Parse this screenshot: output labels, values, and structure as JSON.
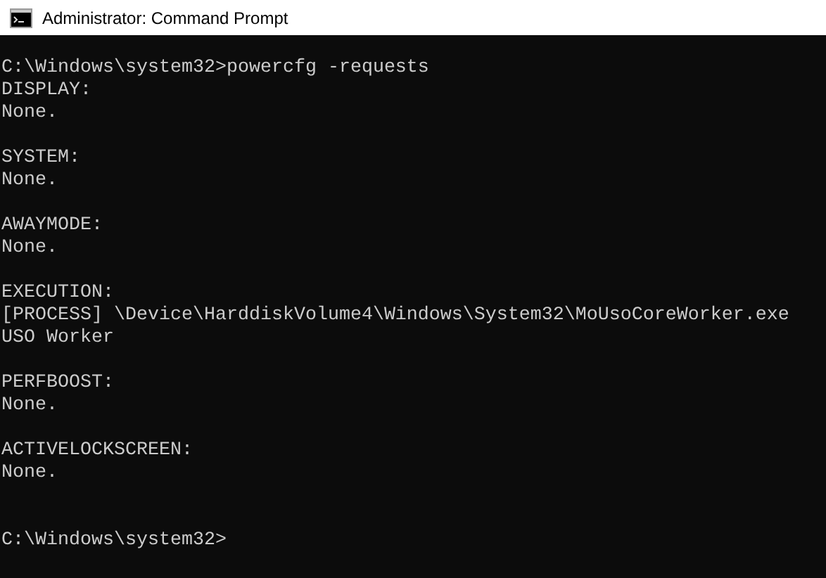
{
  "window": {
    "title": "Administrator: Command Prompt"
  },
  "console": {
    "lines": [
      {
        "kind": "blank"
      },
      {
        "kind": "text",
        "text": "C:\\Windows\\system32>powercfg -requests"
      },
      {
        "kind": "text",
        "text": "DISPLAY:"
      },
      {
        "kind": "text",
        "text": "None."
      },
      {
        "kind": "blank"
      },
      {
        "kind": "text",
        "text": "SYSTEM:"
      },
      {
        "kind": "text",
        "text": "None."
      },
      {
        "kind": "blank"
      },
      {
        "kind": "text",
        "text": "AWAYMODE:"
      },
      {
        "kind": "text",
        "text": "None."
      },
      {
        "kind": "blank"
      },
      {
        "kind": "text",
        "text": "EXECUTION:"
      },
      {
        "kind": "text",
        "text": "[PROCESS] \\Device\\HarddiskVolume4\\Windows\\System32\\MoUsoCoreWorker.exe"
      },
      {
        "kind": "text",
        "text": "USO Worker"
      },
      {
        "kind": "blank"
      },
      {
        "kind": "text",
        "text": "PERFBOOST:"
      },
      {
        "kind": "text",
        "text": "None."
      },
      {
        "kind": "blank"
      },
      {
        "kind": "text",
        "text": "ACTIVELOCKSCREEN:"
      },
      {
        "kind": "text",
        "text": "None."
      },
      {
        "kind": "blank"
      },
      {
        "kind": "blank"
      },
      {
        "kind": "text",
        "text": "C:\\Windows\\system32>"
      }
    ]
  }
}
